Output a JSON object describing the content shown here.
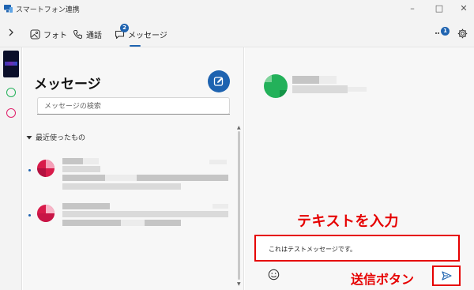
{
  "window": {
    "title": "スマートフォン連携",
    "minimize": "–",
    "maximize": "□",
    "close": "✕"
  },
  "tabs": {
    "photos": "フォト",
    "calls": "通話",
    "messages": "メッセージ",
    "messages_badge": "2"
  },
  "header": {
    "notifications_badge": "1"
  },
  "messages_panel": {
    "title": "メッセージ",
    "search_placeholder": "メッセージの検索",
    "section_label": "最近使ったもの"
  },
  "compose": {
    "draft_text": "これはテストメッセージです。"
  },
  "annotations": {
    "input_hint": "テキストを入力",
    "send_hint": "送信ボタン",
    "highlight_color": "#e60000"
  },
  "colors": {
    "accent": "#1e63b0",
    "titlebar_bg": "#f3f3f3",
    "panel_bg": "#f7f7f7"
  }
}
